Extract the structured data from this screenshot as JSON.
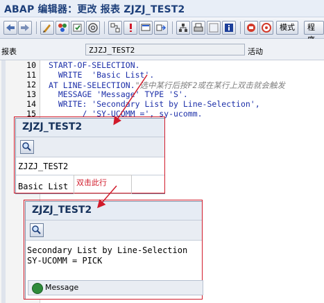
{
  "window": {
    "title": "ABAP 编辑器：更改 报表 ZJZJ_TEST2"
  },
  "toolbar": {
    "buttons": [
      {
        "icon": "back-arrow-icon"
      },
      {
        "icon": "forward-arrow-icon"
      },
      {
        "icon": "display-change-icon"
      },
      {
        "icon": "other-object-icon"
      },
      {
        "icon": "activate-icon"
      },
      {
        "icon": "where-used-icon"
      },
      {
        "icon": "navigate-icon"
      },
      {
        "icon": "stop-icon"
      },
      {
        "icon": "screen-icon"
      },
      {
        "icon": "transfer-icon"
      },
      {
        "icon": "hierarchy-icon"
      },
      {
        "icon": "print-icon"
      },
      {
        "icon": "blank-icon"
      },
      {
        "icon": "info-icon"
      },
      {
        "icon": "breakpoint-icon"
      },
      {
        "icon": "help-icon"
      }
    ],
    "mode_label": "模式",
    "program_label": "程序"
  },
  "fields": {
    "report_label": "报表",
    "report_value": "ZJZJ_TEST2",
    "status_label": "活动"
  },
  "editor": {
    "lines": [
      {
        "no": "10",
        "text": "START-OF-SELECTION."
      },
      {
        "no": "11",
        "text": "  WRITE  'Basic List'."
      },
      {
        "no": "12",
        "text": "AT LINE-SELECTION.",
        "comment": "\"选中某行后按F2或在某行上双击就会触发"
      },
      {
        "no": "13",
        "text": "  MESSAGE 'Message' TYPE 'S'."
      },
      {
        "no": "14",
        "text": "  WRITE: 'Secondary List by Line-Selection',"
      },
      {
        "no": "15",
        "text": "       / 'SY-UCOMM =', sy-ucomm."
      }
    ]
  },
  "popup1": {
    "title": "ZJZJ_TEST2",
    "header_line": "ZJZJ_TEST2",
    "list_line": "Basic List"
  },
  "annotation": {
    "text": "双击此行"
  },
  "popup2": {
    "title": "ZJZJ_TEST2",
    "line1": "Secondary List by Line-Selection",
    "line2": "SY-UCOMM = PICK",
    "status_message": "Message"
  },
  "colors": {
    "annotation_red": "#d11a2a",
    "keyword_blue": "#1b2ea8",
    "title_blue": "#1d3f7a"
  }
}
